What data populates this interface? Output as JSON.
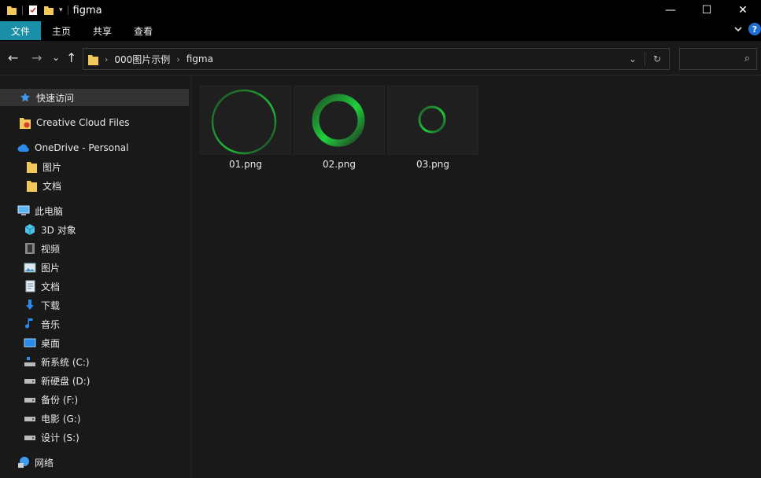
{
  "window": {
    "title": "figma",
    "controls": {
      "minimize": "—",
      "maximize": "☐",
      "close": "✕"
    }
  },
  "ribbon": {
    "tabs": [
      {
        "label": "文件"
      },
      {
        "label": "主页"
      },
      {
        "label": "共享"
      },
      {
        "label": "查看"
      }
    ],
    "expand_icon": "chevron-down-icon",
    "help_label": "?"
  },
  "nav": {
    "back": "←",
    "forward": "→",
    "recent": "⌄",
    "up": "↑",
    "breadcrumb": [
      "000图片示例",
      "figma"
    ],
    "refresh": "↻",
    "dropdown": "⌄",
    "search_placeholder": "",
    "search_icon": "⌕"
  },
  "sidebar": {
    "quick_access": "快速访问",
    "creative_cloud": "Creative Cloud Files",
    "onedrive": "OneDrive - Personal",
    "onedrive_items": [
      "图片",
      "文档"
    ],
    "this_pc": "此电脑",
    "pc_items": [
      "3D 对象",
      "视频",
      "图片",
      "文档",
      "下载",
      "音乐",
      "桌面",
      "新系统 (C:)",
      "新硬盘 (D:)",
      "备份 (F:)",
      "电影 (G:)",
      "设计 (S:)"
    ],
    "network": "网络"
  },
  "files": [
    {
      "name": "01.png",
      "spinner": {
        "style": "thin-fade",
        "color": "#1fd13c"
      }
    },
    {
      "name": "02.png",
      "spinner": {
        "style": "thick-gradient",
        "color": "#1fd13c"
      }
    },
    {
      "name": "03.png",
      "spinner": {
        "style": "small-fade",
        "color": "#1fd13c"
      }
    }
  ],
  "colors": {
    "accent": "#1a8fa8",
    "spinner": "#1fd13c",
    "background": "#191919"
  }
}
